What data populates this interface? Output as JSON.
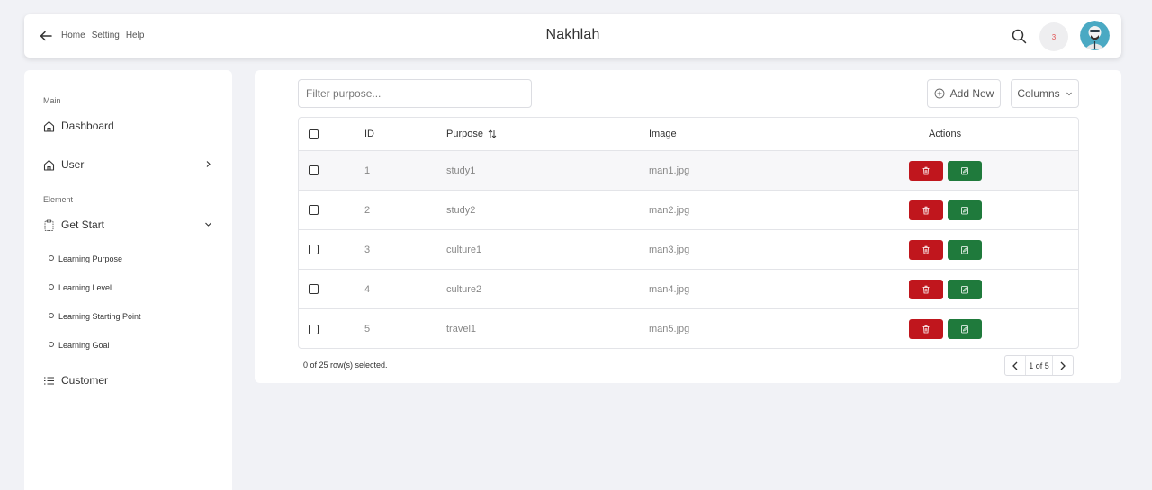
{
  "header": {
    "title": "Nakhlah",
    "nav": [
      "Home",
      "Setting",
      "Help"
    ],
    "notification_count": "3"
  },
  "sidebar": {
    "sections": [
      {
        "label": "Main"
      },
      {
        "label": "Element"
      }
    ],
    "items": [
      {
        "label": "Dashboard",
        "icon": "home-icon"
      },
      {
        "label": "User",
        "icon": "home-icon"
      },
      {
        "label": "Get Start",
        "icon": "clipboard-icon"
      },
      {
        "label": "Customer",
        "icon": "list-icon"
      }
    ],
    "sub_items": [
      "Learning Purpose",
      "Learning Level",
      "Learning Starting Point",
      "Learning Goal"
    ]
  },
  "main": {
    "filter_placeholder": "Filter purpose...",
    "add_new_label": "Add New",
    "columns_label": "Columns",
    "table": {
      "headers": [
        "ID",
        "Purpose",
        "Image",
        "Actions"
      ],
      "rows": [
        {
          "id": "1",
          "purpose": "study1",
          "image": "man1.jpg"
        },
        {
          "id": "2",
          "purpose": "study2",
          "image": "man2.jpg"
        },
        {
          "id": "3",
          "purpose": "culture1",
          "image": "man3.jpg"
        },
        {
          "id": "4",
          "purpose": "culture2",
          "image": "man4.jpg"
        },
        {
          "id": "5",
          "purpose": "travel1",
          "image": "man5.jpg"
        }
      ]
    },
    "selected_info": "0 of 25 row(s) selected.",
    "pagination": "1 of 5"
  },
  "colors": {
    "delete": "#c0161d",
    "edit": "#1f7a3c",
    "background": "#f1f2f6",
    "notification": "#e05353"
  }
}
